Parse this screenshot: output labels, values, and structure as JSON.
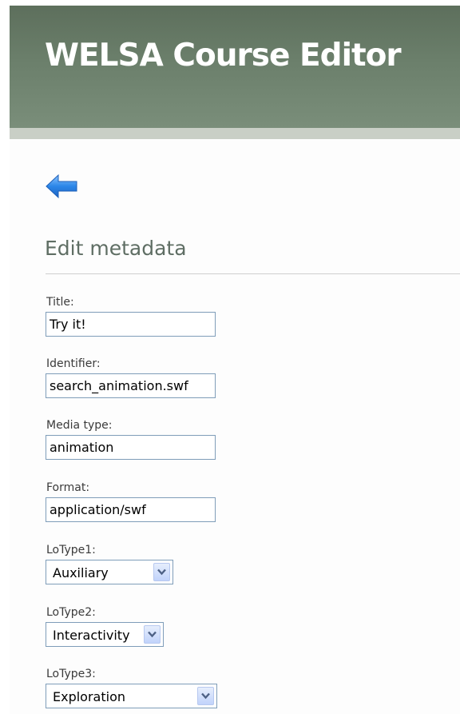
{
  "header": {
    "title": "WELSA Course Editor"
  },
  "page": {
    "title": "Edit metadata"
  },
  "fields": {
    "title": {
      "label": "Title:",
      "value": "Try it!"
    },
    "identifier": {
      "label": "Identifier:",
      "value": "search_animation.swf"
    },
    "media_type": {
      "label": "Media type:",
      "value": "animation"
    },
    "format": {
      "label": "Format:",
      "value": "application/swf"
    },
    "lotype1": {
      "label": "LoType1:",
      "value": "Auxiliary"
    },
    "lotype2": {
      "label": "LoType2:",
      "value": "Interactivity"
    },
    "lotype3": {
      "label": "LoType3:",
      "value": "Exploration"
    }
  },
  "icons": {
    "back": "arrow-left-icon",
    "dropdown": "chevron-down-icon"
  },
  "colors": {
    "header": "#6b7f6b",
    "title_text": "#5f6e64",
    "input_border": "#7f9db9",
    "back_arrow": "#2b86e8"
  }
}
